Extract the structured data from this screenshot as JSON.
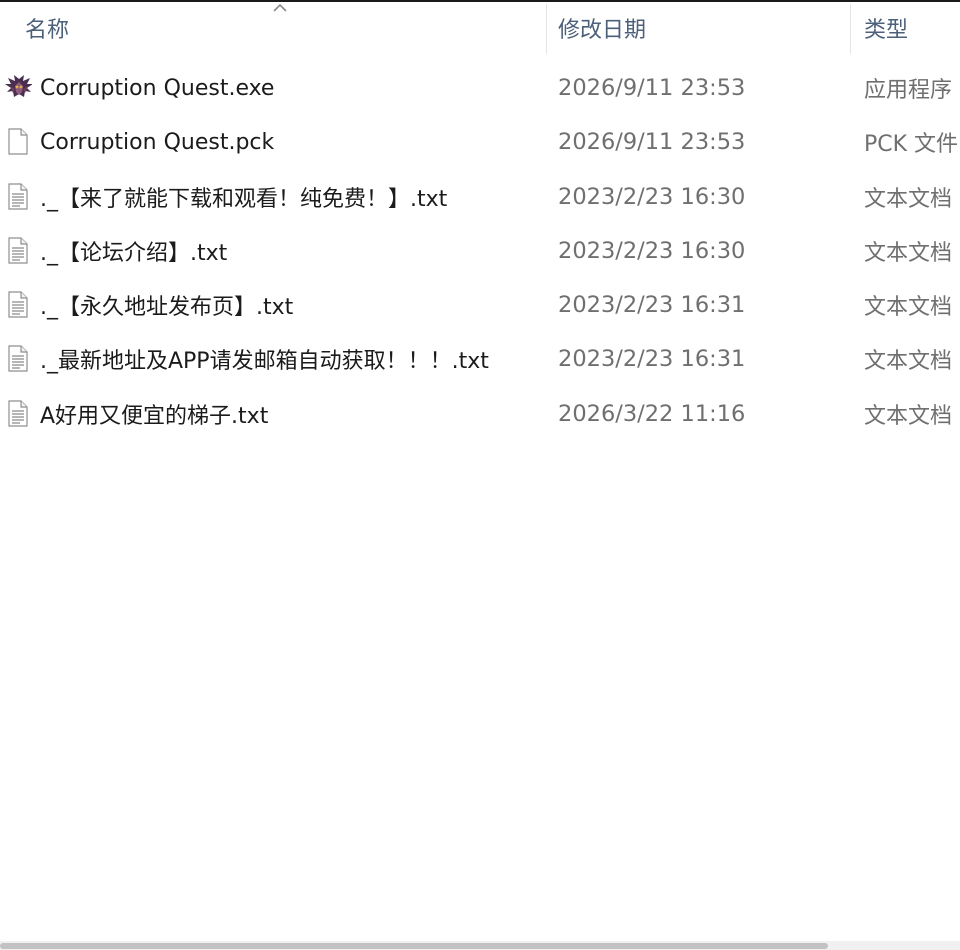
{
  "columns": {
    "name": "名称",
    "date": "修改日期",
    "type": "类型"
  },
  "files": [
    {
      "icon": "game-app-icon",
      "name": "Corruption Quest.exe",
      "date": "2026/9/11 23:53",
      "type": "应用程序"
    },
    {
      "icon": "blank-file-icon",
      "name": "Corruption Quest.pck",
      "date": "2026/9/11 23:53",
      "type": "PCK 文件"
    },
    {
      "icon": "text-document-icon",
      "name": "._【来了就能下载和观看！纯免费！】.txt",
      "date": "2023/2/23 16:30",
      "type": "文本文档"
    },
    {
      "icon": "text-document-icon",
      "name": "._【论坛介绍】.txt",
      "date": "2023/2/23 16:30",
      "type": "文本文档"
    },
    {
      "icon": "text-document-icon",
      "name": "._【永久地址发布页】.txt",
      "date": "2023/2/23 16:31",
      "type": "文本文档"
    },
    {
      "icon": "text-document-icon",
      "name": "._最新地址及APP请发邮箱自动获取！！！.txt",
      "date": "2023/2/23 16:31",
      "type": "文本文档"
    },
    {
      "icon": "text-document-icon",
      "name": "A好用又便宜的梯子.txt",
      "date": "2026/3/22 11:16",
      "type": "文本文档"
    }
  ],
  "colors": {
    "header_text": "#4c607a",
    "name_text": "#1b1b1b",
    "meta_text": "#6f6f6f"
  }
}
